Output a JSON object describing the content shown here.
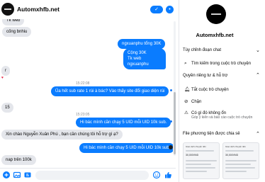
{
  "header": {
    "title": "Automxhfb.net",
    "badge_glyph": "✓",
    "more_glyph": "•"
  },
  "messages": {
    "m1": "Tk web",
    "m2": "cống bnhiu",
    "m3": "ngxuanphu tổng 30K",
    "m4_line1": "Cộng 30K",
    "m4_line2": "Tk web ngxuanphu",
    "stamp1": "r",
    "time1": "15:22:08",
    "m5": "Ủa hết sub rate 1 rùi à bác? Vào thấy site đổi giao diện rùi",
    "m6": "15",
    "time2": "15:23:05",
    "m7": "Hi bác mình cần chạy 5 UID mỗi UID 10k sub.",
    "m8": "Xin chào Nguyễn Xuân Phú , bạn cần chúng tôi hỗ trợ gì ạ?",
    "m9": "Hi bác mình cần chạy 5 UID mỗi UID 10k sub.",
    "m10": "nap trên 100k"
  },
  "info": {
    "name": "Automxhfb.net",
    "section_customize": "Tùy chỉnh đoạn chat",
    "search_label": "Tìm kiếm trong cuộc trò chuyện",
    "section_privacy": "Quyền riêng tư & hỗ trợ",
    "mute_label": "Tắt cuộc trò chuyện",
    "block_label": "Chặn",
    "report_label": "Có gì đó không ổn",
    "report_sub": "Góp ý kiến và báo cáo cuộc trò chuyện",
    "section_media": "File phương tiện được chia sẻ",
    "media1_title": "Giao dịch chuyển tiền",
    "media1_amount": "30,000VND",
    "media2_title": "Giao dịch chuyển tiền",
    "media2_amount": "30,000VND"
  },
  "colors": {
    "accent": "#0a7cff",
    "incoming": "#e4e6eb",
    "text": "#050505"
  },
  "icons": {
    "search": "search-icon",
    "mute": "bell-icon",
    "block": "block-icon",
    "report": "warning-icon"
  }
}
